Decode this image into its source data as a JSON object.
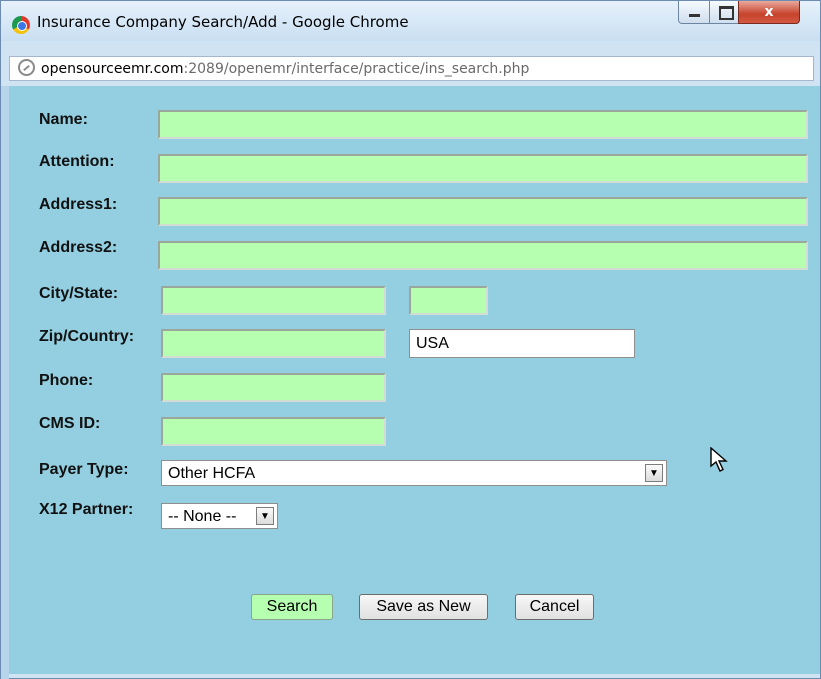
{
  "window": {
    "title": "Insurance Company Search/Add - Google Chrome",
    "close_label": "x"
  },
  "address_bar": {
    "host": "opensourceemr.com",
    "path": ":2089/openemr/interface/practice/ins_search.php"
  },
  "form": {
    "name_label": "Name:",
    "attention_label": "Attention:",
    "address1_label": "Address1:",
    "address2_label": "Address2:",
    "city_state_label": "City/State:",
    "zip_country_label": "Zip/Country:",
    "country_value": "USA",
    "phone_label": "Phone:",
    "cms_id_label": "CMS ID:",
    "payer_type_label": "Payer Type:",
    "payer_type_value": "Other HCFA",
    "x12_partner_label": "X12 Partner:",
    "x12_partner_value": "-- None --"
  },
  "buttons": {
    "search": "Search",
    "save_as_new": "Save as New",
    "cancel": "Cancel"
  },
  "colors": {
    "content_bg": "#93cfe0",
    "field_bg": "#b6ffb0"
  }
}
